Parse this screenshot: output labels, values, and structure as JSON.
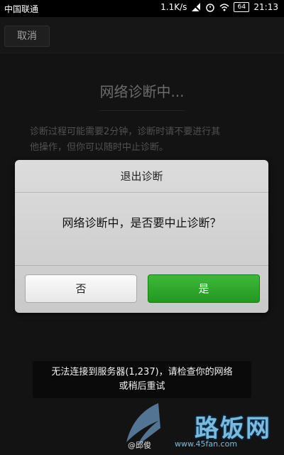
{
  "status_bar": {
    "carrier": "中国联通",
    "net_speed": "1.1K/s",
    "battery": "64",
    "time": "21:13"
  },
  "app_bar": {
    "cancel_label": "取消"
  },
  "diagnosis": {
    "title": "网络诊断中...",
    "description_line1": "诊断过程可能需要2分钟，诊断时请不要进行其",
    "description_line2": "他操作，但你可以随时中止诊断。"
  },
  "dialog": {
    "title": "退出诊断",
    "message": "网络诊断中，是否要中止诊断？",
    "no_label": "否",
    "yes_label": "是"
  },
  "toast": {
    "line1": "无法连接到服务器(1,237)，请检查你的网络",
    "line2": "或稍后重试"
  },
  "watermark": {
    "author": "@邱俊",
    "logo": "路饭网",
    "url": "www.45fan.com"
  },
  "colors": {
    "accent_green": "#2aa827",
    "dialog_bg": "#d4d4d4"
  }
}
